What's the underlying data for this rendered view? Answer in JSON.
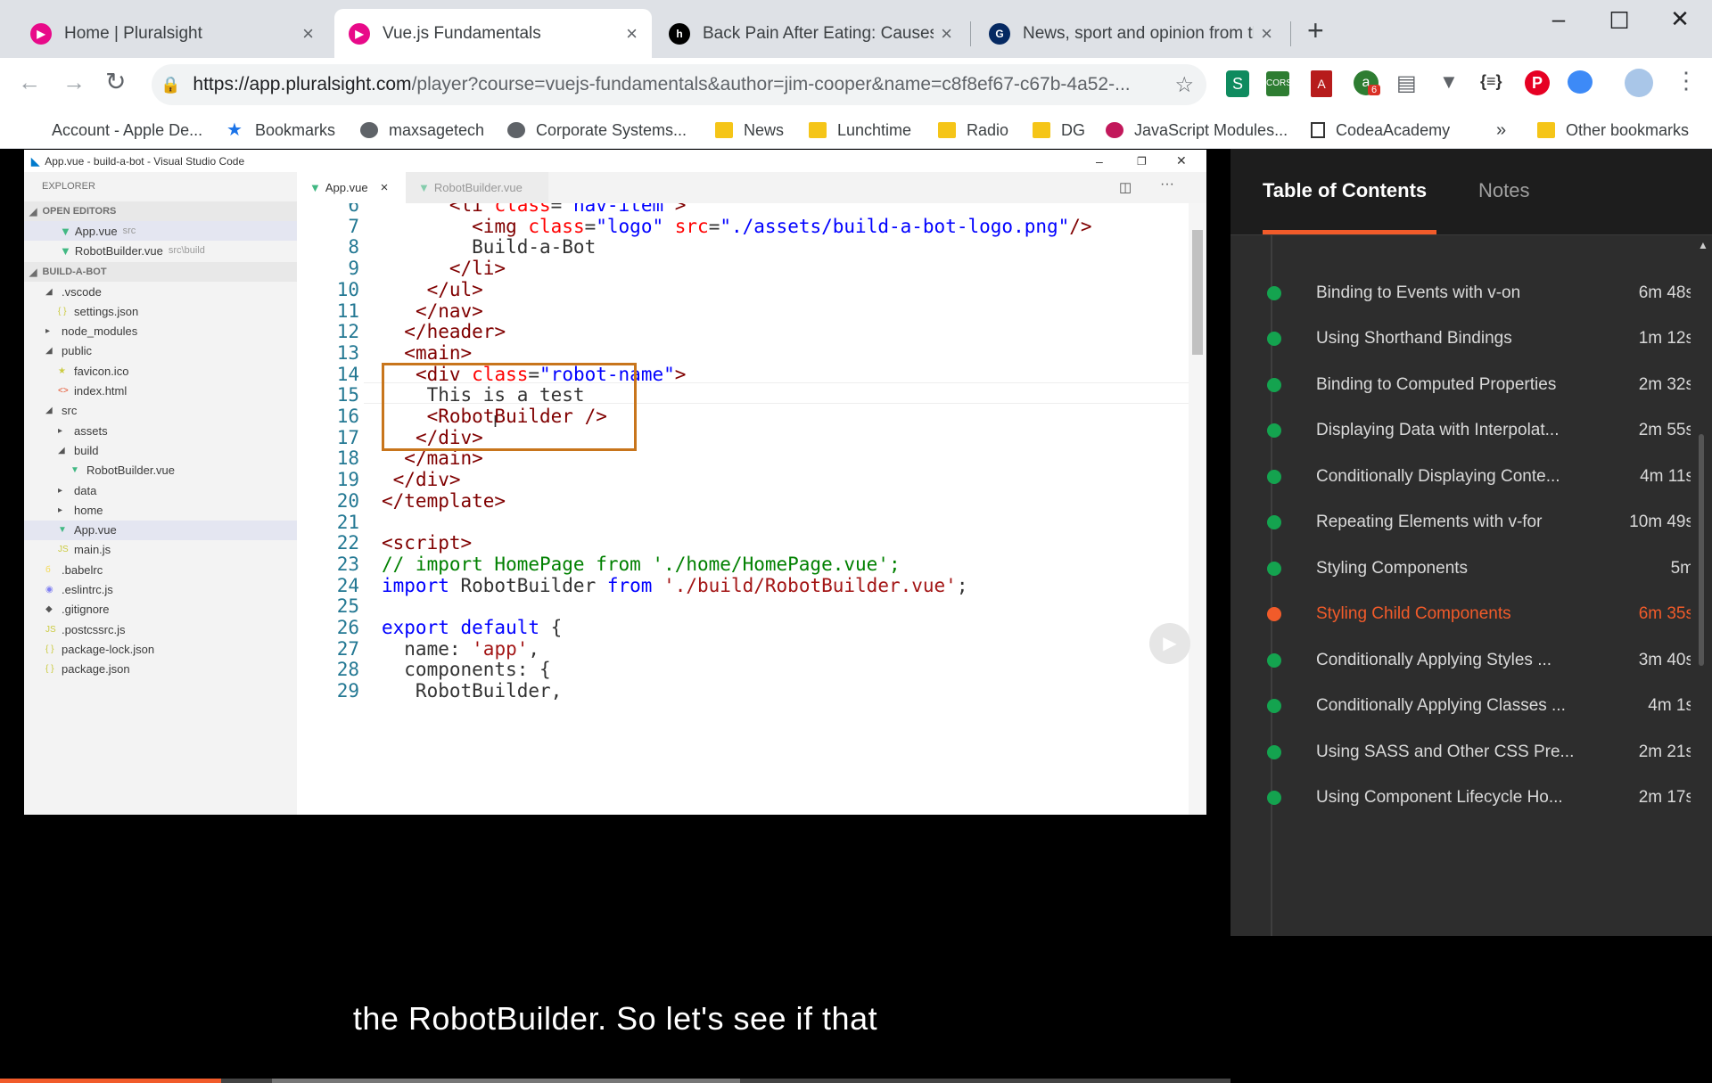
{
  "browser": {
    "tabs": [
      {
        "title": "Home | Pluralsight",
        "favicon": "pluralsight-icon",
        "color": "#e80a89"
      },
      {
        "title": "Vue.js Fundamentals",
        "favicon": "pluralsight-icon",
        "color": "#e80a89"
      },
      {
        "title": "Back Pain After Eating: Causes, Tr",
        "favicon": "healthline-icon",
        "color": "#000000"
      },
      {
        "title": "News, sport and opinion from the",
        "favicon": "guardian-icon",
        "color": "#052962"
      }
    ],
    "new_tab": "+",
    "url_host": "https://app.pluralsight.com",
    "url_path": "/player?course=vuejs-fundamentals&author=jim-cooper&name=c8f8ef67-c67b-4a52-...",
    "extension_badge": "6",
    "bookmarks": [
      {
        "label": "Account - Apple De...",
        "icon": "apple-icon"
      },
      {
        "label": "Bookmarks",
        "icon": "star-icon"
      },
      {
        "label": "maxsagetech",
        "icon": "globe-icon"
      },
      {
        "label": "Corporate Systems...",
        "icon": "globe-icon"
      },
      {
        "label": "News",
        "icon": "folder-icon"
      },
      {
        "label": "Lunchtime",
        "icon": "folder-icon"
      },
      {
        "label": "Radio",
        "icon": "folder-icon"
      },
      {
        "label": "DG",
        "icon": "folder-icon"
      },
      {
        "label": "JavaScript Modules...",
        "icon": "site-icon"
      },
      {
        "label": "CodeaAcademy",
        "icon": "site-icon"
      }
    ],
    "more_bookmarks": "»",
    "other_bookmarks": "Other bookmarks"
  },
  "vscode": {
    "title": "App.vue - build-a-bot - Visual Studio Code",
    "explorer_label": "EXPLORER",
    "open_editors_label": "OPEN EDITORS",
    "open_editors": [
      {
        "name": "App.vue",
        "path": "src"
      },
      {
        "name": "RobotBuilder.vue",
        "path": "src\\build"
      }
    ],
    "project_label": "BUILD-A-BOT",
    "tree": [
      {
        "name": ".vscode",
        "indent": 1,
        "kind": "folder-open"
      },
      {
        "name": "settings.json",
        "indent": 2,
        "kind": "json"
      },
      {
        "name": "node_modules",
        "indent": 1,
        "kind": "folder"
      },
      {
        "name": "public",
        "indent": 1,
        "kind": "folder-open"
      },
      {
        "name": "favicon.ico",
        "indent": 2,
        "kind": "star"
      },
      {
        "name": "index.html",
        "indent": 2,
        "kind": "html"
      },
      {
        "name": "src",
        "indent": 1,
        "kind": "folder-open"
      },
      {
        "name": "assets",
        "indent": 2,
        "kind": "folder"
      },
      {
        "name": "build",
        "indent": 2,
        "kind": "folder-open"
      },
      {
        "name": "RobotBuilder.vue",
        "indent": 3,
        "kind": "vue"
      },
      {
        "name": "data",
        "indent": 2,
        "kind": "folder"
      },
      {
        "name": "home",
        "indent": 2,
        "kind": "folder"
      },
      {
        "name": "App.vue",
        "indent": 2,
        "kind": "vue"
      },
      {
        "name": "main.js",
        "indent": 2,
        "kind": "js"
      },
      {
        "name": ".babelrc",
        "indent": 1,
        "kind": "babel"
      },
      {
        "name": ".eslintrc.js",
        "indent": 1,
        "kind": "eslint"
      },
      {
        "name": ".gitignore",
        "indent": 1,
        "kind": "git"
      },
      {
        "name": ".postcssrc.js",
        "indent": 1,
        "kind": "js"
      },
      {
        "name": "package-lock.json",
        "indent": 1,
        "kind": "json"
      },
      {
        "name": "package.json",
        "indent": 1,
        "kind": "json"
      }
    ],
    "editor_tabs": [
      {
        "name": "App.vue",
        "close": "×"
      },
      {
        "name": "RobotBuilder.vue"
      }
    ],
    "code_lines": [
      {
        "n": "6",
        "tokens": [
          [
            "p",
            "      "
          ],
          [
            "t",
            "<li"
          ],
          [
            "a",
            " class"
          ],
          [
            "p",
            "="
          ],
          [
            "s",
            "\"nav-item\""
          ],
          [
            "t",
            ">"
          ]
        ]
      },
      {
        "n": "7",
        "tokens": [
          [
            "p",
            "        "
          ],
          [
            "t",
            "<img"
          ],
          [
            "a",
            " class"
          ],
          [
            "p",
            "="
          ],
          [
            "s",
            "\"logo\""
          ],
          [
            "a",
            " src"
          ],
          [
            "p",
            "="
          ],
          [
            "s",
            "\"./assets/build-a-bot-logo.png\""
          ],
          [
            "t",
            "/>"
          ]
        ]
      },
      {
        "n": "8",
        "tokens": [
          [
            "p",
            "        Build-a-Bot"
          ]
        ]
      },
      {
        "n": "9",
        "tokens": [
          [
            "p",
            "      "
          ],
          [
            "t",
            "</li>"
          ]
        ]
      },
      {
        "n": "10",
        "tokens": [
          [
            "p",
            "    "
          ],
          [
            "t",
            "</ul>"
          ]
        ]
      },
      {
        "n": "11",
        "tokens": [
          [
            "p",
            "   "
          ],
          [
            "t",
            "</nav>"
          ]
        ]
      },
      {
        "n": "12",
        "tokens": [
          [
            "p",
            "  "
          ],
          [
            "t",
            "</header>"
          ]
        ]
      },
      {
        "n": "13",
        "tokens": [
          [
            "p",
            "  "
          ],
          [
            "t",
            "<main>"
          ]
        ]
      },
      {
        "n": "14",
        "tokens": [
          [
            "p",
            "   "
          ],
          [
            "t",
            "<div"
          ],
          [
            "a",
            " class"
          ],
          [
            "p",
            "="
          ],
          [
            "s",
            "\"robot-name\""
          ],
          [
            "t",
            ">"
          ]
        ]
      },
      {
        "n": "15",
        "tokens": [
          [
            "p",
            "    This is a test"
          ]
        ]
      },
      {
        "n": "16",
        "tokens": [
          [
            "p",
            "    "
          ],
          [
            "t",
            "<RobotBuilder />"
          ]
        ]
      },
      {
        "n": "17",
        "tokens": [
          [
            "p",
            "   "
          ],
          [
            "t",
            "</div>"
          ]
        ]
      },
      {
        "n": "18",
        "tokens": [
          [
            "p",
            "  "
          ],
          [
            "t",
            "</main>"
          ]
        ]
      },
      {
        "n": "19",
        "tokens": [
          [
            "p",
            " "
          ],
          [
            "t",
            "</div>"
          ]
        ]
      },
      {
        "n": "20",
        "tokens": [
          [
            "t",
            "</template>"
          ]
        ]
      },
      {
        "n": "21",
        "tokens": [
          [
            "p",
            ""
          ]
        ]
      },
      {
        "n": "22",
        "tokens": [
          [
            "t",
            "<script>"
          ]
        ]
      },
      {
        "n": "23",
        "tokens": [
          [
            "c",
            "// import HomePage from './home/HomePage.vue';"
          ]
        ]
      },
      {
        "n": "24",
        "tokens": [
          [
            "k",
            "import"
          ],
          [
            "p",
            " RobotBuilder "
          ],
          [
            "k",
            "from"
          ],
          [
            "st",
            " './build/RobotBuilder.vue'"
          ],
          [
            "p",
            ";"
          ]
        ]
      },
      {
        "n": "25",
        "tokens": [
          [
            "p",
            ""
          ]
        ]
      },
      {
        "n": "26",
        "tokens": [
          [
            "k",
            "export default"
          ],
          [
            "p",
            " {"
          ]
        ]
      },
      {
        "n": "27",
        "tokens": [
          [
            "p",
            "  name: "
          ],
          [
            "st",
            "'app'"
          ],
          [
            "p",
            ","
          ]
        ]
      },
      {
        "n": "28",
        "tokens": [
          [
            "p",
            "  components: {"
          ]
        ]
      },
      {
        "n": "29",
        "tokens": [
          [
            "p",
            "   RobotBuilder,"
          ]
        ]
      }
    ]
  },
  "video": {
    "subtitle": "the RobotBuilder. So let's see if that",
    "progress": 0.18
  },
  "panel": {
    "tabs": [
      "Table of Contents",
      "Notes"
    ],
    "items": [
      {
        "title": "Binding to Events with v-on",
        "duration": "6m 48s",
        "status": "done"
      },
      {
        "title": "Using Shorthand Bindings",
        "duration": "1m 12s",
        "status": "done"
      },
      {
        "title": "Binding to Computed Properties",
        "duration": "2m 32s",
        "status": "done"
      },
      {
        "title": "Displaying Data with Interpolat...",
        "duration": "2m 55s",
        "status": "done"
      },
      {
        "title": "Conditionally Displaying Conte...",
        "duration": "4m 11s",
        "status": "done"
      },
      {
        "title": "Repeating Elements with v-for",
        "duration": "10m 49s",
        "status": "done"
      },
      {
        "title": "Styling Components",
        "duration": "5m",
        "status": "done"
      },
      {
        "title": "Styling Child Components",
        "duration": "6m 35s",
        "status": "current"
      },
      {
        "title": "Conditionally Applying Styles ...",
        "duration": "3m 40s",
        "status": "done"
      },
      {
        "title": "Conditionally Applying Classes ...",
        "duration": "4m 1s",
        "status": "done"
      },
      {
        "title": "Using SASS and Other CSS Pre...",
        "duration": "2m 21s",
        "status": "done"
      },
      {
        "title": "Using Component Lifecycle Ho...",
        "duration": "2m 17s",
        "status": "done"
      }
    ]
  },
  "colors": {
    "accent": "#f15b2a",
    "done": "#14a34f",
    "highlight_box": "#c8751c"
  }
}
